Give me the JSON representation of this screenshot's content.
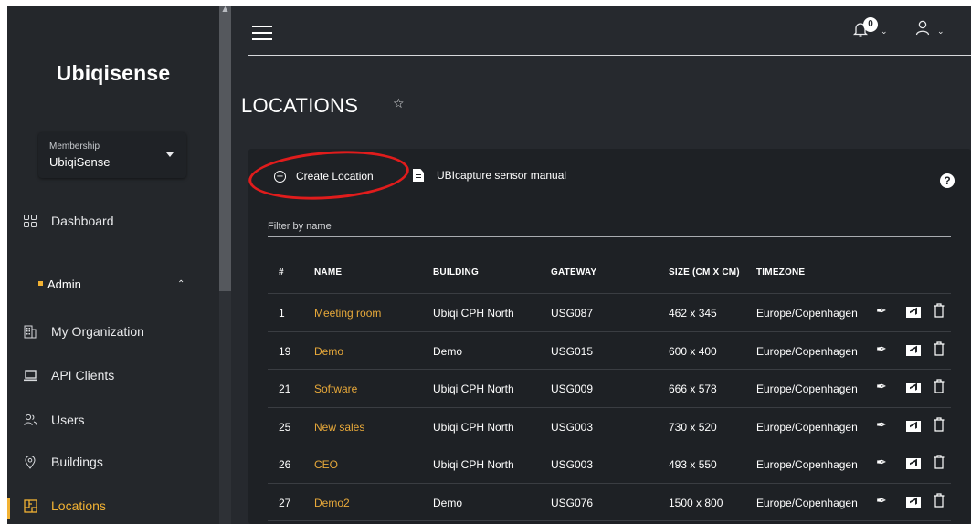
{
  "sidebar": {
    "logo": "Ubiqisense",
    "membership": {
      "caption": "Membership",
      "value": "UbiqiSense"
    },
    "dashboard": "Dashboard",
    "admin": "Admin",
    "items": [
      {
        "label": "My Organization",
        "icon": "building-icon"
      },
      {
        "label": "API Clients",
        "icon": "laptop-icon"
      },
      {
        "label": "Users",
        "icon": "users-icon"
      },
      {
        "label": "Buildings",
        "icon": "location-pin-icon"
      },
      {
        "label": "Locations",
        "icon": "floorplan-icon",
        "active": true
      }
    ]
  },
  "header": {
    "notification_count": "0"
  },
  "page": {
    "title": "LOCATIONS"
  },
  "toolbar": {
    "create_label": "Create Location",
    "manual_label": "UBIcapture sensor manual",
    "help_label": "?"
  },
  "filter": {
    "placeholder": "Filter by name",
    "value": ""
  },
  "table": {
    "columns": [
      "#",
      "NAME",
      "BUILDING",
      "GATEWAY",
      "SIZE (CM X CM)",
      "TIMEZONE"
    ],
    "rows": [
      {
        "id": "1",
        "name": "Meeting room",
        "building": "Ubiqi CPH North",
        "gateway": "USG087",
        "size": "462 x 345",
        "timezone": "Europe/Copenhagen"
      },
      {
        "id": "19",
        "name": "Demo",
        "building": "Demo",
        "gateway": "USG015",
        "size": "600 x 400",
        "timezone": "Europe/Copenhagen"
      },
      {
        "id": "21",
        "name": "Software",
        "building": "Ubiqi CPH North",
        "gateway": "USG009",
        "size": "666 x 578",
        "timezone": "Europe/Copenhagen"
      },
      {
        "id": "25",
        "name": "New sales",
        "building": "Ubiqi CPH North",
        "gateway": "USG003",
        "size": "730 x 520",
        "timezone": "Europe/Copenhagen"
      },
      {
        "id": "26",
        "name": "CEO",
        "building": "Ubiqi CPH North",
        "gateway": "USG003",
        "size": "493 x 550",
        "timezone": "Europe/Copenhagen"
      },
      {
        "id": "27",
        "name": "Demo2",
        "building": "Demo",
        "gateway": "USG076",
        "size": "1500 x 800",
        "timezone": "Europe/Copenhagen"
      }
    ]
  },
  "colors": {
    "accent": "#f2b233",
    "link": "#e8a93a",
    "annotation": "#e01c1c",
    "background": "#26292e",
    "card": "#1e2125"
  }
}
